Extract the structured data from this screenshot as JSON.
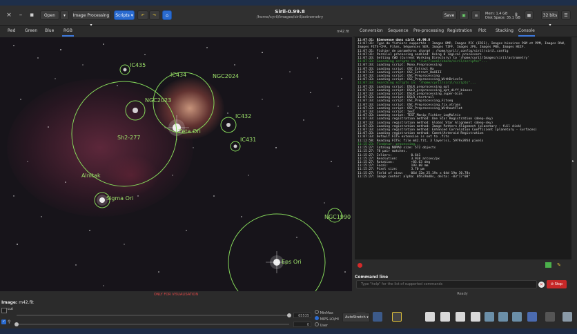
{
  "window": {
    "title": "Siril-0.99.8",
    "path": "/home/cyril/Images/siril/astrometry",
    "open_label": "Open",
    "image_processing_label": "Image Processing",
    "scripts_label": "Scripts",
    "save_label": "Save",
    "mem_label": "Mem: 1.4 GB",
    "disk_label": "Disk Space: 35.1 GB",
    "threads": "8",
    "bits_label": "32 bits"
  },
  "channels": [
    "Red",
    "Green",
    "Blue",
    "RGB"
  ],
  "active_channel": "RGB",
  "image": {
    "filename_corner": "m42.fit",
    "objects": [
      "IC435",
      "IC434",
      "NGC2024",
      "NGC2023",
      "IC432",
      "Zeta Ori",
      "IC431",
      "Sh2-277",
      "Alnitak",
      "Sigma Ori",
      "NGC1990",
      "Eps Ori"
    ],
    "warning": "ONLY FOR VISUALISATION"
  },
  "bottom": {
    "image_label": "Image:",
    "image_name": "m42.fit",
    "cut_label": "cut",
    "hi_value": "65535",
    "lo_value": "0",
    "modes": [
      "MinMax",
      "MIPS-LO/HI",
      "User"
    ],
    "selected_mode": "MIPS-LO/HI",
    "stretch_label": "AutoStretch"
  },
  "tabs": [
    "Conversion",
    "Sequence",
    "Pre-processing",
    "Registration",
    "Plot",
    "Stacking",
    "Console"
  ],
  "active_tab": "Console",
  "console": [
    {
      "t": "11:07:31:",
      "m": "Bienvenue dans siril v0.99.8",
      "s": "bold"
    },
    {
      "t": "11:07:31:",
      "m": "Type de fichiers supportés : Images BMP, Images PIC (IRIS), Images binaires PGM et PPM, Images RAW,",
      "s": "normal"
    },
    {
      "t": "",
      "m": "Images FITS-CFA, Films, Séquences SER, Images TIFF, Images JPG, Images PNG, Images HEIF.",
      "s": "normal"
    },
    {
      "t": "11:07:31:",
      "m": "Fichier de paramètres chargé : /home/cyril/.config/siril/siril.config",
      "s": "normal"
    },
    {
      "t": "11:07:31:",
      "m": "Parallel processing enabled: Using 8 logical processors",
      "s": "normal"
    },
    {
      "t": "11:07:33:",
      "m": "Setting CWD (Current Working Directory) to '/home/cyril/Images/siril/astrometry'",
      "s": "normal"
    },
    {
      "t": "11:07:33:",
      "m": "Searching scripts in: \"/usr/local/share/siril/scripts/\"...",
      "s": "green"
    },
    {
      "t": "11:07:33:",
      "m": "Loading script: Mono_Preprocessing",
      "s": "normal"
    },
    {
      "t": "11:07:33:",
      "m": "Loading script: OSC_Extract_Ha",
      "s": "normal"
    },
    {
      "t": "11:07:33:",
      "m": "Loading script: OSC_Extract_HaOIII",
      "s": "normal"
    },
    {
      "t": "11:07:33:",
      "m": "Loading script: OSC_Preprocessing",
      "s": "normal"
    },
    {
      "t": "11:07:33:",
      "m": "Loading script: OSC_Preprocessing_WithDrizzle",
      "s": "normal"
    },
    {
      "t": "11:07:33:",
      "m": "Searching scripts in: \"/home/cyril/siril/scripts\"...",
      "s": "green"
    },
    {
      "t": "11:07:33:",
      "m": "Loading script: DSLR_preprocessing_opt",
      "s": "normal"
    },
    {
      "t": "11:07:33:",
      "m": "Loading script: DSLR_preprocessing_opt_diff_biases",
      "s": "normal"
    },
    {
      "t": "11:07:33:",
      "m": "Loading script: DSLR_preprocessing_super-bias",
      "s": "normal"
    },
    {
      "t": "11:07:33:",
      "m": "Loading script: DSLR_startrail",
      "s": "normal"
    },
    {
      "t": "11:07:33:",
      "m": "Loading script: OSC_Preprocessing_Fitseq",
      "s": "normal"
    },
    {
      "t": "11:07:33:",
      "m": "Loading script: OSC_Preprocessing_fix_xtrans",
      "s": "normal"
    },
    {
      "t": "11:07:33:",
      "m": "Loading script: OSC_Preprocessing_WithoutFlat",
      "s": "normal"
    },
    {
      "t": "11:07:33:",
      "m": "Loading script: test",
      "s": "normal"
    },
    {
      "t": "11:07:33:",
      "m": "Loading script: TEST_Manip_Fichier_LogMultiv",
      "s": "normal"
    },
    {
      "t": "11:07:33:",
      "m": "Loading registration method: One Star Registration (deep-sky)",
      "s": "normal"
    },
    {
      "t": "11:07:33:",
      "m": "Loading registration method: Global Star Alignment (deep-sky)",
      "s": "normal"
    },
    {
      "t": "11:07:33:",
      "m": "Loading registration method: Image Pattern Alignment (planetary - full disk)",
      "s": "normal"
    },
    {
      "t": "11:07:33:",
      "m": "Loading registration method: Enhanced Correlation Coefficient (planetary - surfaces)",
      "s": "normal"
    },
    {
      "t": "11:07:33:",
      "m": "Loading registration method: Comet/Asteroid Registration",
      "s": "normal"
    },
    {
      "t": "11:07:33:",
      "m": "Default FITS extension is set to .fits",
      "s": "normal"
    },
    {
      "t": "11:12:58:",
      "m": "Reading FITS: file m42.fit, 3 layer(s), 5979x3954 pixels",
      "s": "normal"
    },
    {
      "t": "11:15:23:",
      "m": "Findstar: processing...",
      "s": "green"
    },
    {
      "t": "11:15:27:",
      "m": "Catalog NOMAD size: 572 objects",
      "s": "normal"
    },
    {
      "t": "11:15:27:",
      "m": "78 pair matches.",
      "s": "normal"
    },
    {
      "t": "11:15:27:",
      "m": "Inliers:          0.641",
      "s": "normal"
    },
    {
      "t": "11:15:27:",
      "m": "Resolution:       3.938 arcsec/px",
      "s": "normal"
    },
    {
      "t": "11:15:27:",
      "m": "Rotation:         +85.63 deg",
      "s": "normal"
    },
    {
      "t": "11:15:27:",
      "m": "Focal:            193.80 mm",
      "s": "normal"
    },
    {
      "t": "11:15:27:",
      "m": "Pixel size:       3.70 µm",
      "s": "normal"
    },
    {
      "t": "11:15:27:",
      "m": "Field of view:    06d 32m 25.19s x 04d 19m 30.78s",
      "s": "normal"
    },
    {
      "t": "11:15:27:",
      "m": "Image center: alpha: 05h37m48s, delta: -03°17'08\"",
      "s": "normal"
    }
  ],
  "command": {
    "label": "Command line",
    "placeholder": "Type \"help\" for the list of supported commands",
    "stop_label": "Stop",
    "status": "Ready"
  }
}
